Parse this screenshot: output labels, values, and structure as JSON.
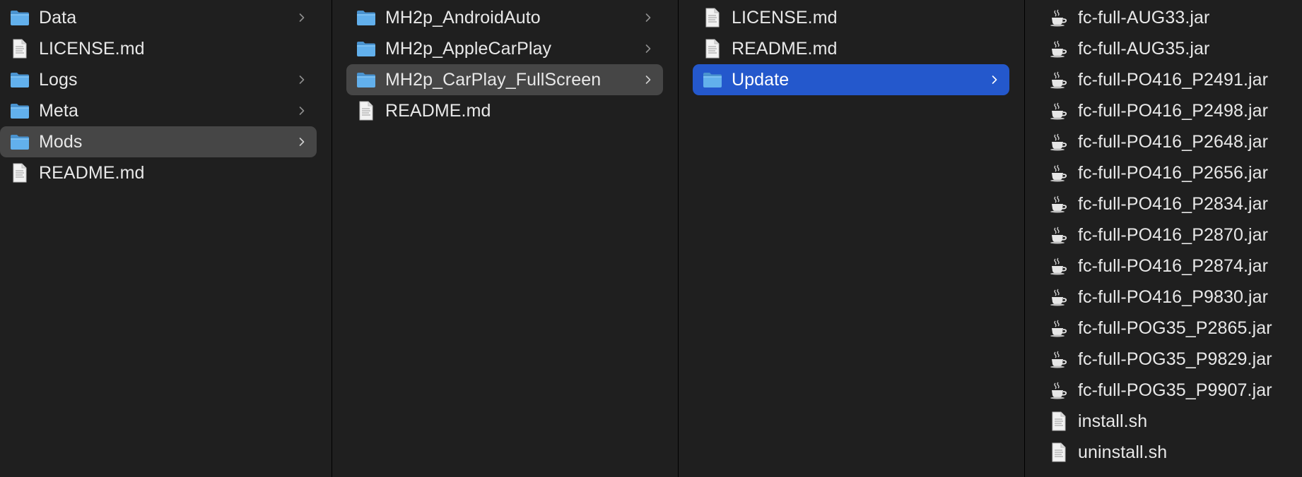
{
  "columns": [
    {
      "items": [
        {
          "label": "Data",
          "type": "folder",
          "icon": "folder-icon",
          "state": "normal"
        },
        {
          "label": "LICENSE.md",
          "type": "file",
          "icon": "document-icon",
          "state": "normal"
        },
        {
          "label": "Logs",
          "type": "folder",
          "icon": "folder-icon",
          "state": "normal"
        },
        {
          "label": "Meta",
          "type": "folder",
          "icon": "folder-icon",
          "state": "normal"
        },
        {
          "label": "Mods",
          "type": "folder",
          "icon": "folder-icon",
          "state": "selected-inactive"
        },
        {
          "label": "README.md",
          "type": "file",
          "icon": "document-icon",
          "state": "normal"
        }
      ]
    },
    {
      "items": [
        {
          "label": "MH2p_AndroidAuto",
          "type": "folder",
          "icon": "folder-icon",
          "state": "normal"
        },
        {
          "label": "MH2p_AppleCarPlay",
          "type": "folder",
          "icon": "folder-icon",
          "state": "normal"
        },
        {
          "label": "MH2p_CarPlay_FullScreen",
          "type": "folder",
          "icon": "folder-icon",
          "state": "selected-inactive"
        },
        {
          "label": "README.md",
          "type": "file",
          "icon": "document-icon",
          "state": "normal"
        }
      ]
    },
    {
      "items": [
        {
          "label": "LICENSE.md",
          "type": "file",
          "icon": "document-icon",
          "state": "normal"
        },
        {
          "label": "README.md",
          "type": "file",
          "icon": "document-icon",
          "state": "normal"
        },
        {
          "label": "Update",
          "type": "folder",
          "icon": "folder-icon",
          "state": "selected-active"
        }
      ]
    },
    {
      "items": [
        {
          "label": "fc-full-AUG33.jar",
          "type": "jar",
          "icon": "java-jar-icon",
          "state": "normal"
        },
        {
          "label": "fc-full-AUG35.jar",
          "type": "jar",
          "icon": "java-jar-icon",
          "state": "normal"
        },
        {
          "label": "fc-full-PO416_P2491.jar",
          "type": "jar",
          "icon": "java-jar-icon",
          "state": "normal"
        },
        {
          "label": "fc-full-PO416_P2498.jar",
          "type": "jar",
          "icon": "java-jar-icon",
          "state": "normal"
        },
        {
          "label": "fc-full-PO416_P2648.jar",
          "type": "jar",
          "icon": "java-jar-icon",
          "state": "normal"
        },
        {
          "label": "fc-full-PO416_P2656.jar",
          "type": "jar",
          "icon": "java-jar-icon",
          "state": "normal"
        },
        {
          "label": "fc-full-PO416_P2834.jar",
          "type": "jar",
          "icon": "java-jar-icon",
          "state": "normal"
        },
        {
          "label": "fc-full-PO416_P2870.jar",
          "type": "jar",
          "icon": "java-jar-icon",
          "state": "normal"
        },
        {
          "label": "fc-full-PO416_P2874.jar",
          "type": "jar",
          "icon": "java-jar-icon",
          "state": "normal"
        },
        {
          "label": "fc-full-PO416_P9830.jar",
          "type": "jar",
          "icon": "java-jar-icon",
          "state": "normal"
        },
        {
          "label": "fc-full-POG35_P2865.jar",
          "type": "jar",
          "icon": "java-jar-icon",
          "state": "normal"
        },
        {
          "label": "fc-full-POG35_P9829.jar",
          "type": "jar",
          "icon": "java-jar-icon",
          "state": "normal"
        },
        {
          "label": "fc-full-POG35_P9907.jar",
          "type": "jar",
          "icon": "java-jar-icon",
          "state": "normal"
        },
        {
          "label": "install.sh",
          "type": "file",
          "icon": "document-icon",
          "state": "normal"
        },
        {
          "label": "uninstall.sh",
          "type": "file",
          "icon": "document-icon",
          "state": "normal"
        }
      ]
    }
  ],
  "colors": {
    "background": "#1f1f1f",
    "selected_inactive": "#464646",
    "selected_active": "#2458cc",
    "folder": "#5aa9e6",
    "text": "#e8e8e8"
  }
}
